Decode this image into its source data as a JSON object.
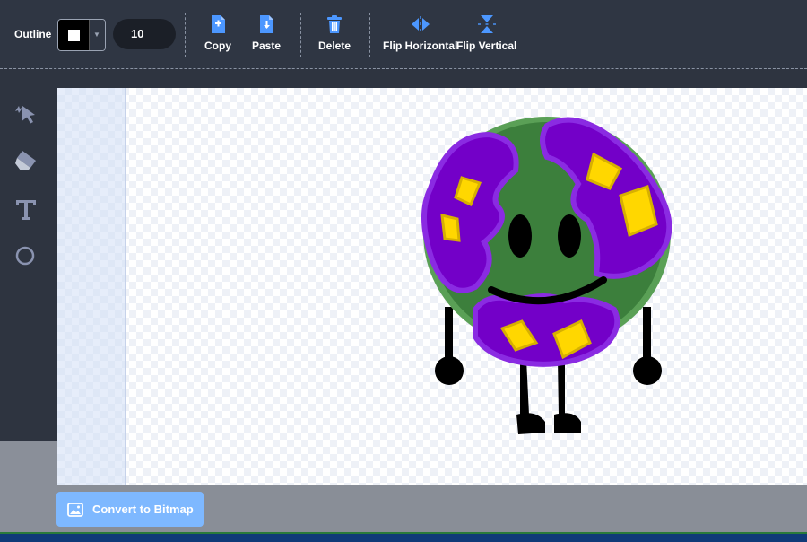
{
  "toolbar": {
    "outline_label": "Outline",
    "outline_color": "#000000",
    "outline_width": "10",
    "copy_label": "Copy",
    "paste_label": "Paste",
    "delete_label": "Delete",
    "flip_h_label": "Flip Horizontal",
    "flip_v_label": "Flip Vertical"
  },
  "tools": [
    {
      "name": "reshape",
      "icon": "reshape-pointer-icon"
    },
    {
      "name": "eraser",
      "icon": "eraser-icon"
    },
    {
      "name": "text",
      "icon": "text-icon"
    },
    {
      "name": "circle",
      "icon": "circle-icon"
    }
  ],
  "footer": {
    "convert_label": "Convert to Bitmap"
  },
  "colors": {
    "accent": "#4c97ff",
    "button": "#7eb8ff",
    "toolbar_bg": "#2f3643",
    "character_green": "#3c7f3c",
    "character_purple": "#7a00c8",
    "character_yellow": "#ffd700"
  }
}
